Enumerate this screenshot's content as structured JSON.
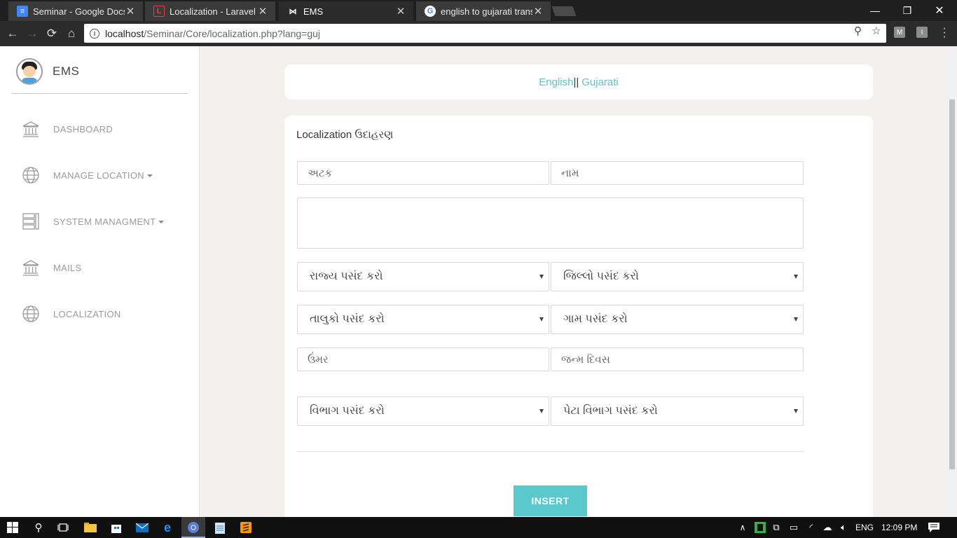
{
  "browser": {
    "tabs": [
      {
        "title": "Seminar - Google Docs",
        "icon": "google-docs-icon",
        "color": "#4285f4"
      },
      {
        "title": "Localization - Laravel - Th",
        "icon": "laravel-icon",
        "color": "#e0463a"
      },
      {
        "title": "EMS",
        "icon": "bow-tie-icon",
        "color": "#111111"
      },
      {
        "title": "english to gujarati transla",
        "icon": "google-icon",
        "color": "#ffffff"
      }
    ],
    "url_host": "localhost",
    "url_path": "/Seminar/Core/localization.php?lang=guj",
    "extensions": [
      "M",
      "I"
    ]
  },
  "sidebar": {
    "brand": "EMS",
    "items": [
      {
        "label": "DASHBOARD",
        "icon": "bank-icon",
        "dropdown": false
      },
      {
        "label": "MANAGE LOCATION",
        "icon": "globe-icon",
        "dropdown": true
      },
      {
        "label": "SYSTEM MANAGMENT",
        "icon": "server-icon",
        "dropdown": true
      },
      {
        "label": "MAILS",
        "icon": "bank-icon",
        "dropdown": false
      },
      {
        "label": "LOCALIZATION",
        "icon": "globe-icon",
        "dropdown": false
      }
    ]
  },
  "lang": {
    "english": "English",
    "separator": "||",
    "gujarati": "Gujarati"
  },
  "form": {
    "title": "Localization ઉદાહરણ",
    "surname_placeholder": "અટક",
    "name_placeholder": "નામ",
    "address_placeholder": "",
    "state_select": "રાજ્ય પસંદ કરો",
    "district_select": "જિલ્લો પસંદ કરો",
    "taluka_select": "તાલુકો પસંદ કરો",
    "village_select": "ગામ પસંદ કરો",
    "age_placeholder": "ઉંમર",
    "birthday_placeholder": "જન્મ દિવસ",
    "department_select": "વિભાગ પસંદ કરો",
    "subdepartment_select": "પેટા વિભાગ પસંદ કરો",
    "insert_label": "INSERT"
  },
  "taskbar": {
    "language": "ENG",
    "time": "12:09 PM"
  }
}
